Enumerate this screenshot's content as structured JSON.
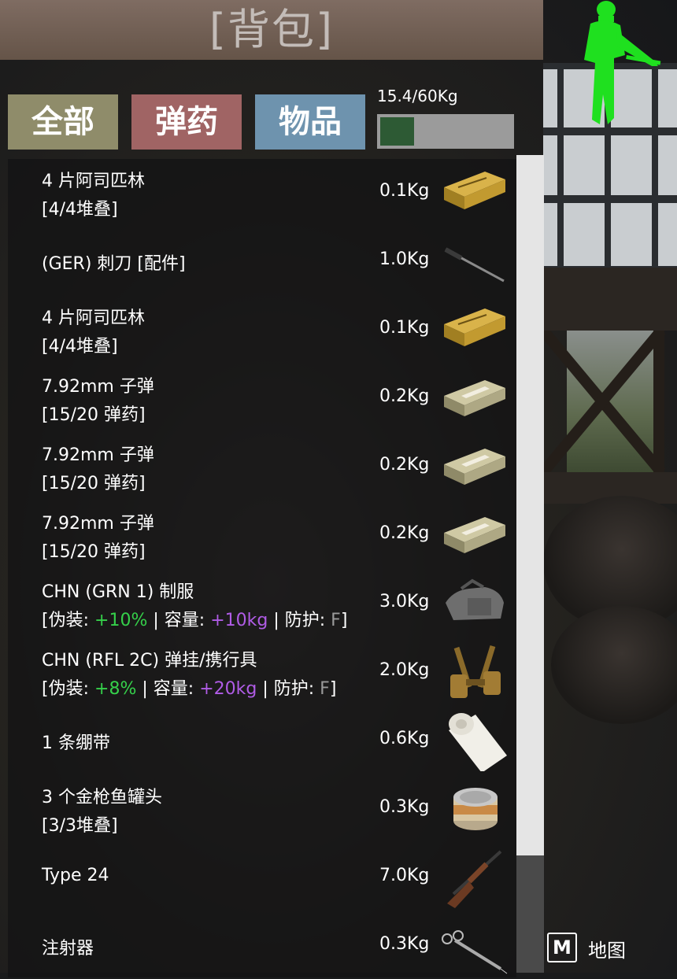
{
  "header": {
    "title": "[背包]"
  },
  "tabs": [
    {
      "label": "全部"
    },
    {
      "label": "弹药"
    },
    {
      "label": "物品"
    }
  ],
  "weight": {
    "text": "15.4/60Kg",
    "fraction": 0.257
  },
  "items": [
    {
      "name": "4 片阿司匹林",
      "sub": "[4/4堆叠]",
      "weight": "0.1Kg",
      "icon": "aspirin-box-icon"
    },
    {
      "name": "(GER) 刺刀 [配件]",
      "weight": "1.0Kg",
      "icon": "bayonet-icon"
    },
    {
      "name": "4 片阿司匹林",
      "sub": "[4/4堆叠]",
      "weight": "0.1Kg",
      "icon": "aspirin-box-icon"
    },
    {
      "name": "7.92mm 子弹",
      "sub": "[15/20 弹药]",
      "weight": "0.2Kg",
      "icon": "ammo-box-icon"
    },
    {
      "name": "7.92mm 子弹",
      "sub": "[15/20 弹药]",
      "weight": "0.2Kg",
      "icon": "ammo-box-icon"
    },
    {
      "name": "7.92mm 子弹",
      "sub": "[15/20 弹药]",
      "weight": "0.2Kg",
      "icon": "ammo-box-icon"
    },
    {
      "name": "CHN (GRN 1) 制服",
      "stats": {
        "camo_label": "伪装:",
        "camo": "+10%",
        "cap_label": "容量:",
        "cap": "+10kg",
        "armor_label": "防护:",
        "armor": "F"
      },
      "weight": "3.0Kg",
      "icon": "uniform-icon"
    },
    {
      "name": "CHN (RFL 2C) 弹挂/携行具",
      "stats": {
        "camo_label": "伪装:",
        "camo": "+8%",
        "cap_label": "容量:",
        "cap": "+20kg",
        "armor_label": "防护:",
        "armor": "F"
      },
      "weight": "2.0Kg",
      "icon": "webbing-icon"
    },
    {
      "name": "1 条绷带",
      "weight": "0.6Kg",
      "icon": "bandage-icon"
    },
    {
      "name": "3 个金枪鱼罐头",
      "sub": "[3/3堆叠]",
      "weight": "0.3Kg",
      "icon": "tuna-can-icon"
    },
    {
      "name": "Type 24",
      "weight": "7.0Kg",
      "icon": "rifle-icon"
    },
    {
      "name": "注射器",
      "weight": "0.3Kg",
      "icon": "syringe-icon"
    }
  ],
  "map_hint": {
    "key": "M",
    "label": "地图"
  },
  "colors": {
    "positive": "#35d04a",
    "capacity": "#b05ce6",
    "accent_soldier": "#1fe01f"
  }
}
